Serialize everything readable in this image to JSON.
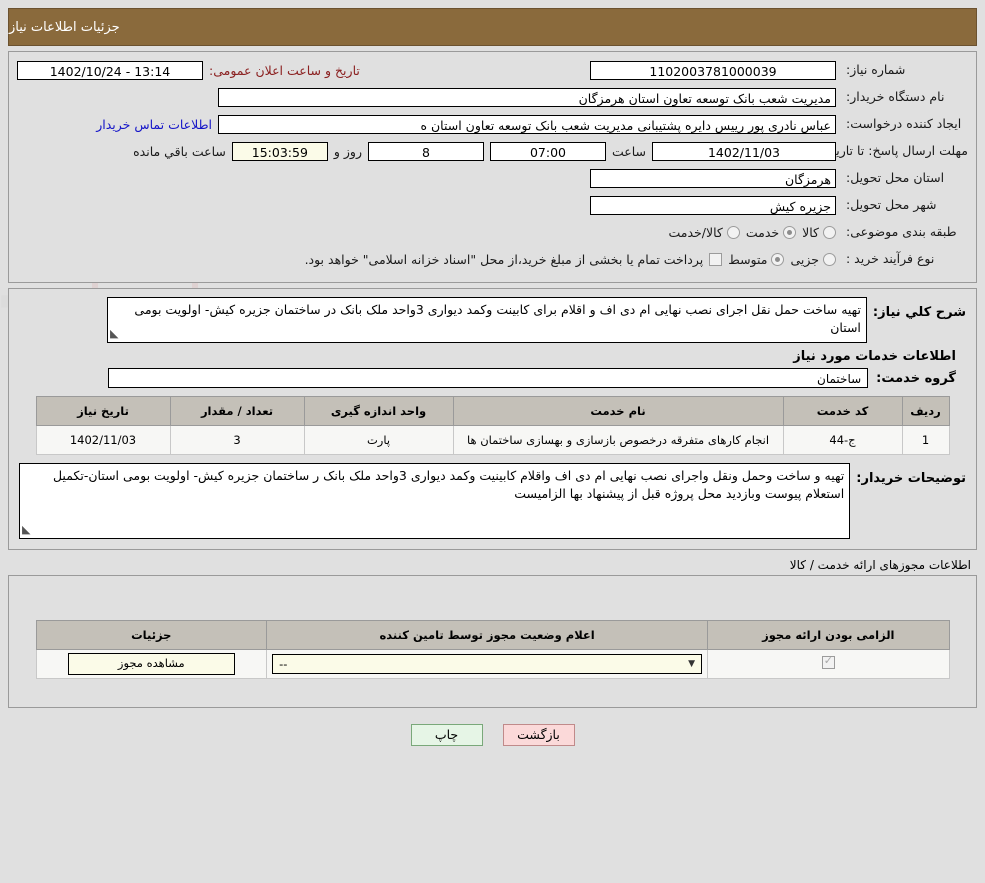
{
  "header": {
    "title": "جزئیات اطلاعات نیاز"
  },
  "info": {
    "need_number_label": "شماره نیاز:",
    "need_number": "1102003781000039",
    "public_announce_label": "تاریخ و ساعت اعلان عمومی:",
    "public_announce_value": "13:14 - 1402/10/24",
    "buyer_org_label": "نام دستگاه خریدار:",
    "buyer_org": "مدیریت شعب بانک توسعه تعاون استان هرمزگان",
    "requester_label": "ایجاد کننده درخواست:",
    "requester": "عباس نادری پور رییس دایره پشتیبانی مدیریت شعب بانک توسعه تعاون استان ه",
    "contact_link": "اطلاعات تماس خریدار",
    "deadline_label": "مهلت ارسال پاسخ: تا تاریخ:",
    "deadline_date": "1402/11/03",
    "time_label": "ساعت",
    "deadline_time": "07:00",
    "days_value": "8",
    "days_label": "روز و",
    "remaining_time": "15:03:59",
    "remaining_label": "ساعت باقي مانده",
    "province_label": "استان محل تحویل:",
    "province": "هرمزگان",
    "city_label": "شهر محل تحویل:",
    "city": "جزیره کیش",
    "classification_label": "طبقه بندی موضوعی:",
    "classification_options": [
      {
        "label": "کالا",
        "selected": false
      },
      {
        "label": "خدمت",
        "selected": true
      },
      {
        "label": "کالا/خدمت",
        "selected": false
      }
    ],
    "process_label": "نوع فرآیند خرید :",
    "process_options": [
      {
        "label": "جزیی",
        "selected": false
      },
      {
        "label": "متوسط",
        "selected": true
      }
    ],
    "treasury_checkbox_checked": false,
    "treasury_note": "پرداخت تمام یا بخشی از مبلغ خرید،از محل \"اسناد خزانه اسلامی\" خواهد بود."
  },
  "need_desc": {
    "label": "شرح کلي نیاز:",
    "text": "تهیه ساخت حمل نقل اجرای نصب نهایی ام دی اف و اقلام برای کابینت وکمد دیواری 3واحد ملک بانک در ساختمان جزیره کیش- اولویت بومی استان"
  },
  "services": {
    "section_title": "اطلاعات خدمات مورد نیاز",
    "group_label": "گروه خدمت:",
    "group_value": "ساختمان",
    "columns": [
      "ردیف",
      "کد خدمت",
      "نام خدمت",
      "واحد اندازه گیری",
      "تعداد / مقدار",
      "تاریخ نیاز"
    ],
    "rows": [
      {
        "index": "1",
        "code": "ج-44",
        "name": "انجام کارهای متفرقه درخصوص بازسازی و بهسازی ساختمان ها",
        "unit": "پارت",
        "quantity": "3",
        "need_date": "1402/11/03"
      }
    ]
  },
  "buyer_notes": {
    "label": "توضیحات خریدار:",
    "text": "تهیه و ساخت وحمل ونقل واجرای نصب نهایی ام دی اف واقلام کابینیت وکمد دیواری 3واحد ملک بانک ر ساختمان جزیره کیش- اولویت بومی استان-تکمیل استعلام پیوست وبازدید محل پروژه قبل از پیشنهاد بها الزامیست"
  },
  "permits": {
    "section_label": "اطلاعات مجوزهای ارائه خدمت / کالا",
    "columns": [
      "الزامی بودن ارائه مجوز",
      "اعلام وضعیت مجوز توسط تامین کننده",
      "جزئیات"
    ],
    "rows": [
      {
        "required_checked": true,
        "status_value": "--",
        "detail_label": "مشاهده مجوز"
      }
    ]
  },
  "footer": {
    "print_label": "چاپ",
    "back_label": "بازگشت"
  },
  "colors": {
    "header_bg": "#8a6a3c",
    "page_bg": "#e0e0e0",
    "link": "#1414c8",
    "accent_red": "#8b2020",
    "print_btn_bg": "#e6f5e6",
    "back_btn_bg": "#fbd9d9",
    "table_header_bg": "#c4c0b8",
    "cream_field": "#fbfbe8"
  }
}
